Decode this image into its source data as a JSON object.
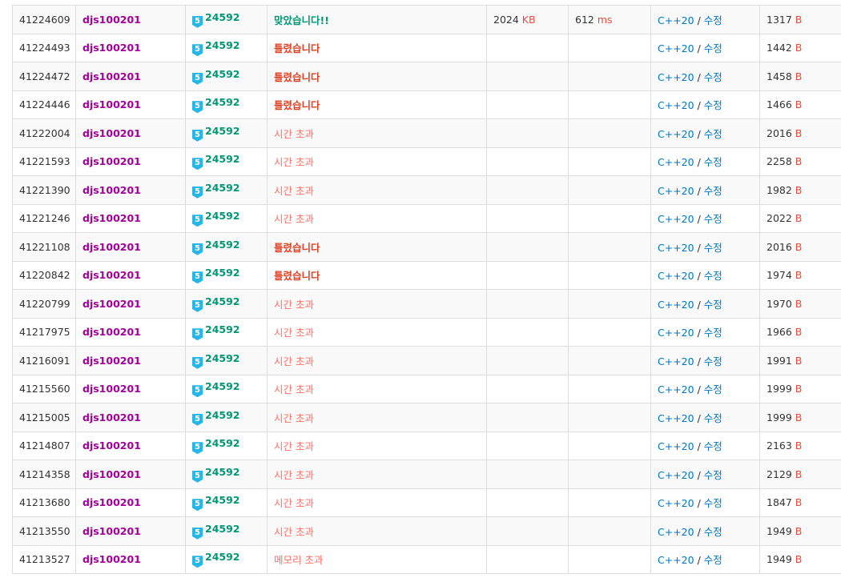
{
  "colors": {
    "username": "#a3009a",
    "problem": "#009874",
    "accepted": "#009874",
    "wrong": "#dd4124",
    "time_limit": "#fa7268",
    "unit": "#e74c3c",
    "link": "#0076c0",
    "tier_badge": "#27b6e6"
  },
  "icons": {
    "tier": "solvedac-tier-badge-icon"
  },
  "separator": "/",
  "rows": [
    {
      "id": "41224609",
      "user": "djs100201",
      "tier": "5",
      "problem": "24592",
      "result": "맞았습니다!!",
      "status": "ac",
      "memory": "2024",
      "memory_unit": "KB",
      "time": "612",
      "time_unit": "ms",
      "lang": "C++20",
      "edit": "수정",
      "length": "1317",
      "length_unit": "B"
    },
    {
      "id": "41224493",
      "user": "djs100201",
      "tier": "5",
      "problem": "24592",
      "result": "틀렸습니다",
      "status": "wa",
      "memory": "",
      "memory_unit": "",
      "time": "",
      "time_unit": "",
      "lang": "C++20",
      "edit": "수정",
      "length": "1442",
      "length_unit": "B"
    },
    {
      "id": "41224472",
      "user": "djs100201",
      "tier": "5",
      "problem": "24592",
      "result": "틀렸습니다",
      "status": "wa",
      "memory": "",
      "memory_unit": "",
      "time": "",
      "time_unit": "",
      "lang": "C++20",
      "edit": "수정",
      "length": "1458",
      "length_unit": "B"
    },
    {
      "id": "41224446",
      "user": "djs100201",
      "tier": "5",
      "problem": "24592",
      "result": "틀렸습니다",
      "status": "wa",
      "memory": "",
      "memory_unit": "",
      "time": "",
      "time_unit": "",
      "lang": "C++20",
      "edit": "수정",
      "length": "1466",
      "length_unit": "B"
    },
    {
      "id": "41222004",
      "user": "djs100201",
      "tier": "5",
      "problem": "24592",
      "result": "시간 초과",
      "status": "tle",
      "memory": "",
      "memory_unit": "",
      "time": "",
      "time_unit": "",
      "lang": "C++20",
      "edit": "수정",
      "length": "2016",
      "length_unit": "B"
    },
    {
      "id": "41221593",
      "user": "djs100201",
      "tier": "5",
      "problem": "24592",
      "result": "시간 초과",
      "status": "tle",
      "memory": "",
      "memory_unit": "",
      "time": "",
      "time_unit": "",
      "lang": "C++20",
      "edit": "수정",
      "length": "2258",
      "length_unit": "B"
    },
    {
      "id": "41221390",
      "user": "djs100201",
      "tier": "5",
      "problem": "24592",
      "result": "시간 초과",
      "status": "tle",
      "memory": "",
      "memory_unit": "",
      "time": "",
      "time_unit": "",
      "lang": "C++20",
      "edit": "수정",
      "length": "1982",
      "length_unit": "B"
    },
    {
      "id": "41221246",
      "user": "djs100201",
      "tier": "5",
      "problem": "24592",
      "result": "시간 초과",
      "status": "tle",
      "memory": "",
      "memory_unit": "",
      "time": "",
      "time_unit": "",
      "lang": "C++20",
      "edit": "수정",
      "length": "2022",
      "length_unit": "B"
    },
    {
      "id": "41221108",
      "user": "djs100201",
      "tier": "5",
      "problem": "24592",
      "result": "틀렸습니다",
      "status": "wa",
      "memory": "",
      "memory_unit": "",
      "time": "",
      "time_unit": "",
      "lang": "C++20",
      "edit": "수정",
      "length": "2016",
      "length_unit": "B"
    },
    {
      "id": "41220842",
      "user": "djs100201",
      "tier": "5",
      "problem": "24592",
      "result": "틀렸습니다",
      "status": "wa",
      "memory": "",
      "memory_unit": "",
      "time": "",
      "time_unit": "",
      "lang": "C++20",
      "edit": "수정",
      "length": "1974",
      "length_unit": "B"
    },
    {
      "id": "41220799",
      "user": "djs100201",
      "tier": "5",
      "problem": "24592",
      "result": "시간 초과",
      "status": "tle",
      "memory": "",
      "memory_unit": "",
      "time": "",
      "time_unit": "",
      "lang": "C++20",
      "edit": "수정",
      "length": "1970",
      "length_unit": "B"
    },
    {
      "id": "41217975",
      "user": "djs100201",
      "tier": "5",
      "problem": "24592",
      "result": "시간 초과",
      "status": "tle",
      "memory": "",
      "memory_unit": "",
      "time": "",
      "time_unit": "",
      "lang": "C++20",
      "edit": "수정",
      "length": "1966",
      "length_unit": "B"
    },
    {
      "id": "41216091",
      "user": "djs100201",
      "tier": "5",
      "problem": "24592",
      "result": "시간 초과",
      "status": "tle",
      "memory": "",
      "memory_unit": "",
      "time": "",
      "time_unit": "",
      "lang": "C++20",
      "edit": "수정",
      "length": "1991",
      "length_unit": "B"
    },
    {
      "id": "41215560",
      "user": "djs100201",
      "tier": "5",
      "problem": "24592",
      "result": "시간 초과",
      "status": "tle",
      "memory": "",
      "memory_unit": "",
      "time": "",
      "time_unit": "",
      "lang": "C++20",
      "edit": "수정",
      "length": "1999",
      "length_unit": "B"
    },
    {
      "id": "41215005",
      "user": "djs100201",
      "tier": "5",
      "problem": "24592",
      "result": "시간 초과",
      "status": "tle",
      "memory": "",
      "memory_unit": "",
      "time": "",
      "time_unit": "",
      "lang": "C++20",
      "edit": "수정",
      "length": "1999",
      "length_unit": "B"
    },
    {
      "id": "41214807",
      "user": "djs100201",
      "tier": "5",
      "problem": "24592",
      "result": "시간 초과",
      "status": "tle",
      "memory": "",
      "memory_unit": "",
      "time": "",
      "time_unit": "",
      "lang": "C++20",
      "edit": "수정",
      "length": "2163",
      "length_unit": "B"
    },
    {
      "id": "41214358",
      "user": "djs100201",
      "tier": "5",
      "problem": "24592",
      "result": "시간 초과",
      "status": "tle",
      "memory": "",
      "memory_unit": "",
      "time": "",
      "time_unit": "",
      "lang": "C++20",
      "edit": "수정",
      "length": "2129",
      "length_unit": "B"
    },
    {
      "id": "41213680",
      "user": "djs100201",
      "tier": "5",
      "problem": "24592",
      "result": "시간 초과",
      "status": "tle",
      "memory": "",
      "memory_unit": "",
      "time": "",
      "time_unit": "",
      "lang": "C++20",
      "edit": "수정",
      "length": "1847",
      "length_unit": "B"
    },
    {
      "id": "41213550",
      "user": "djs100201",
      "tier": "5",
      "problem": "24592",
      "result": "시간 초과",
      "status": "tle",
      "memory": "",
      "memory_unit": "",
      "time": "",
      "time_unit": "",
      "lang": "C++20",
      "edit": "수정",
      "length": "1949",
      "length_unit": "B"
    },
    {
      "id": "41213527",
      "user": "djs100201",
      "tier": "5",
      "problem": "24592",
      "result": "메모리 초과",
      "status": "mle",
      "memory": "",
      "memory_unit": "",
      "time": "",
      "time_unit": "",
      "lang": "C++20",
      "edit": "수정",
      "length": "1949",
      "length_unit": "B"
    }
  ]
}
